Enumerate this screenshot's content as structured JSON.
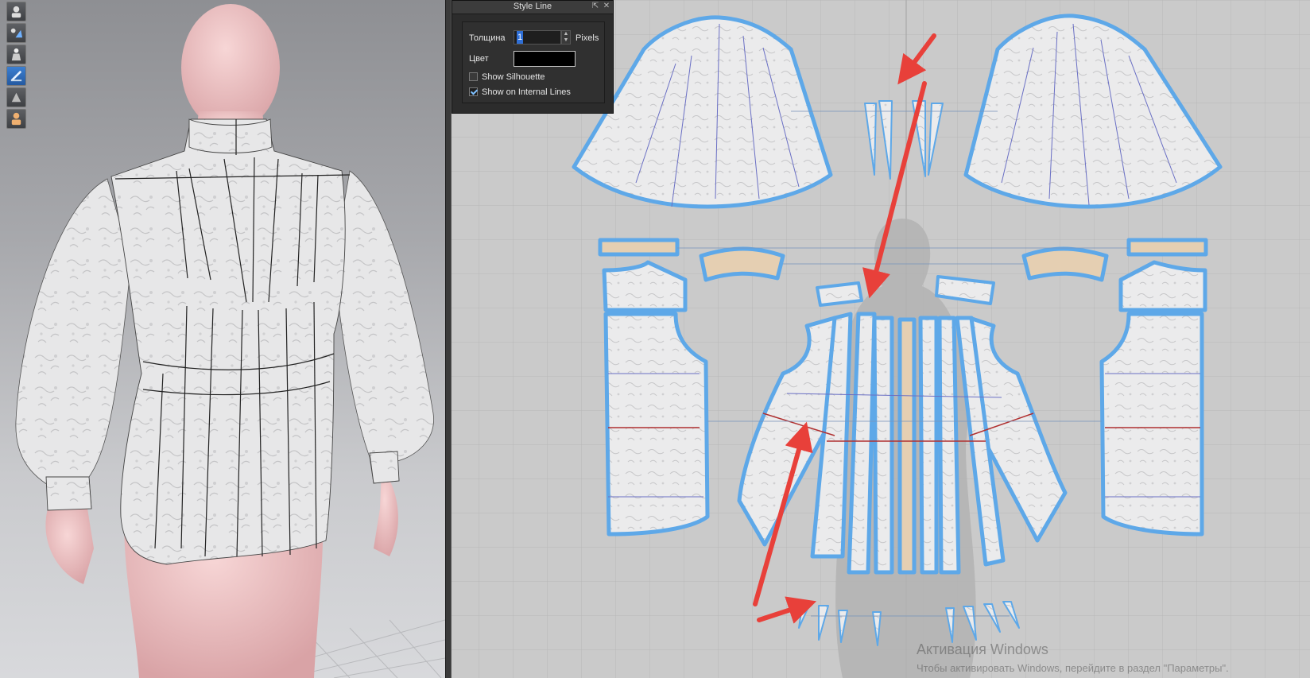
{
  "style_line_panel": {
    "title": "Style Line",
    "thickness_label": "Толщина",
    "thickness_value": "1",
    "thickness_unit": "Pixels",
    "color_label": "Цвет",
    "color_value": "#000000",
    "show_silhouette_label": "Show Silhouette",
    "show_silhouette_checked": false,
    "show_internal_lines_label": "Show on Internal Lines",
    "show_internal_lines_checked": true
  },
  "toolbar_3d": {
    "tools": [
      "avatar-display-icon",
      "avatar-texture-icon",
      "avatar-body-icon",
      "garment-display-icon",
      "surface-display-icon",
      "skin-avatar-icon"
    ],
    "active_tool": "garment-display-icon"
  },
  "watermark": {
    "line1": "Активация Windows",
    "line2": "Чтобы активировать Windows, перейдите в раздел \"Параметры\"."
  },
  "colors": {
    "pattern_outline": "#5ea8e8",
    "annotation_arrow": "#e8403a",
    "fabric": "#e9e9ea",
    "trim_piece": "#e5cfb2",
    "avatar_skin": "#eebfbf"
  }
}
